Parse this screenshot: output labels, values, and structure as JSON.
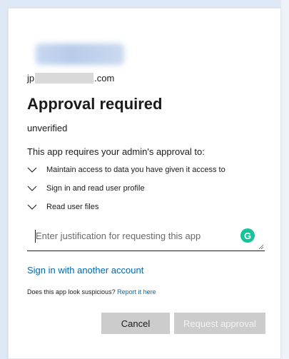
{
  "account": {
    "email_prefix": "jp",
    "email_suffix": ".com"
  },
  "title": "Approval required",
  "status": "unverified",
  "intro": "This app requires your admin's approval to:",
  "permissions": [
    "Maintain access to data you have given it access to",
    "Sign in and read user profile",
    "Read user files"
  ],
  "justification": {
    "placeholder": "Enter justification for requesting this app",
    "grammarly_icon_letter": "G"
  },
  "sign_in_other": "Sign in with another account",
  "suspicious": {
    "question": "Does this app look suspicious?",
    "report_link": "Report it here"
  },
  "buttons": {
    "cancel": "Cancel",
    "request": "Request approval"
  },
  "colors": {
    "accent": "#0067b8",
    "button_bg": "#cccccc",
    "grammarly": "#15c39a"
  }
}
